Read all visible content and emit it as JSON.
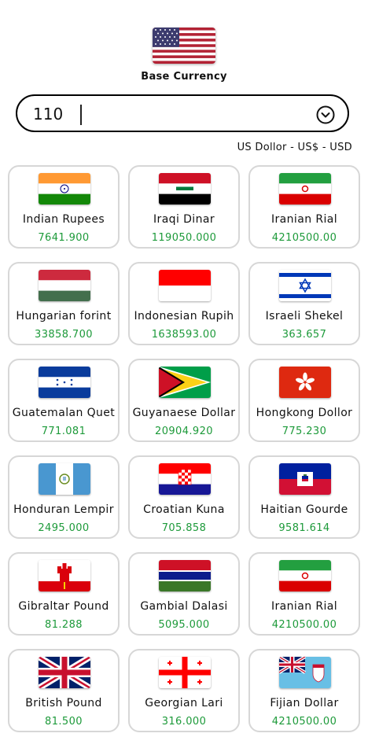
{
  "base": {
    "flag_icon": "us-flag-icon",
    "label": "Base Currency",
    "amount": "110",
    "currency_name": "US Dollor - US$ - USD",
    "dropdown_icon": "chevron-down-circle-icon"
  },
  "colors": {
    "value_green": "#1d9a3a",
    "card_border": "#d7d7d7"
  },
  "currencies": [
    {
      "name": "Indian Rupees",
      "value": "7641.900",
      "flag": "india-flag-icon"
    },
    {
      "name": "Iraqi Dinar",
      "value": "119050.000",
      "flag": "iraq-flag-icon"
    },
    {
      "name": "Iranian Rial",
      "value": "4210500.00",
      "flag": "iran-flag-icon"
    },
    {
      "name": "Hungarian forint",
      "value": "33858.700",
      "flag": "hungary-flag-icon"
    },
    {
      "name": "Indonesian Rupih",
      "value": "1638593.00",
      "flag": "indonesia-flag-icon"
    },
    {
      "name": "Israeli Shekel",
      "value": "363.657",
      "flag": "israel-flag-icon"
    },
    {
      "name": "Guatemalan Quet",
      "value": "771.081",
      "flag": "honduras-flag-icon"
    },
    {
      "name": "Guyanaese Dollar",
      "value": "20904.920",
      "flag": "guyana-flag-icon"
    },
    {
      "name": "Hongkong Dollor",
      "value": "775.230",
      "flag": "hong-kong-flag-icon"
    },
    {
      "name": "Honduran Lempir",
      "value": "2495.000",
      "flag": "guatemala-flag-icon"
    },
    {
      "name": "Croatian Kuna",
      "value": "705.858",
      "flag": "croatia-flag-icon"
    },
    {
      "name": "Haitian Gourde",
      "value": "9581.614",
      "flag": "haiti-flag-icon"
    },
    {
      "name": "Gibraltar Pound",
      "value": "81.288",
      "flag": "gibraltar-flag-icon"
    },
    {
      "name": "Gambial Dalasi",
      "value": "5095.000",
      "flag": "gambia-flag-icon"
    },
    {
      "name": "Iranian Rial",
      "value": "4210500.00",
      "flag": "iran-flag-icon"
    },
    {
      "name": "British Pound",
      "value": "81.500",
      "flag": "uk-flag-icon"
    },
    {
      "name": "Georgian Lari",
      "value": "316.000",
      "flag": "georgia-flag-icon"
    },
    {
      "name": "Fijian Dollar",
      "value": "4210500.00",
      "flag": "fiji-flag-icon"
    }
  ]
}
